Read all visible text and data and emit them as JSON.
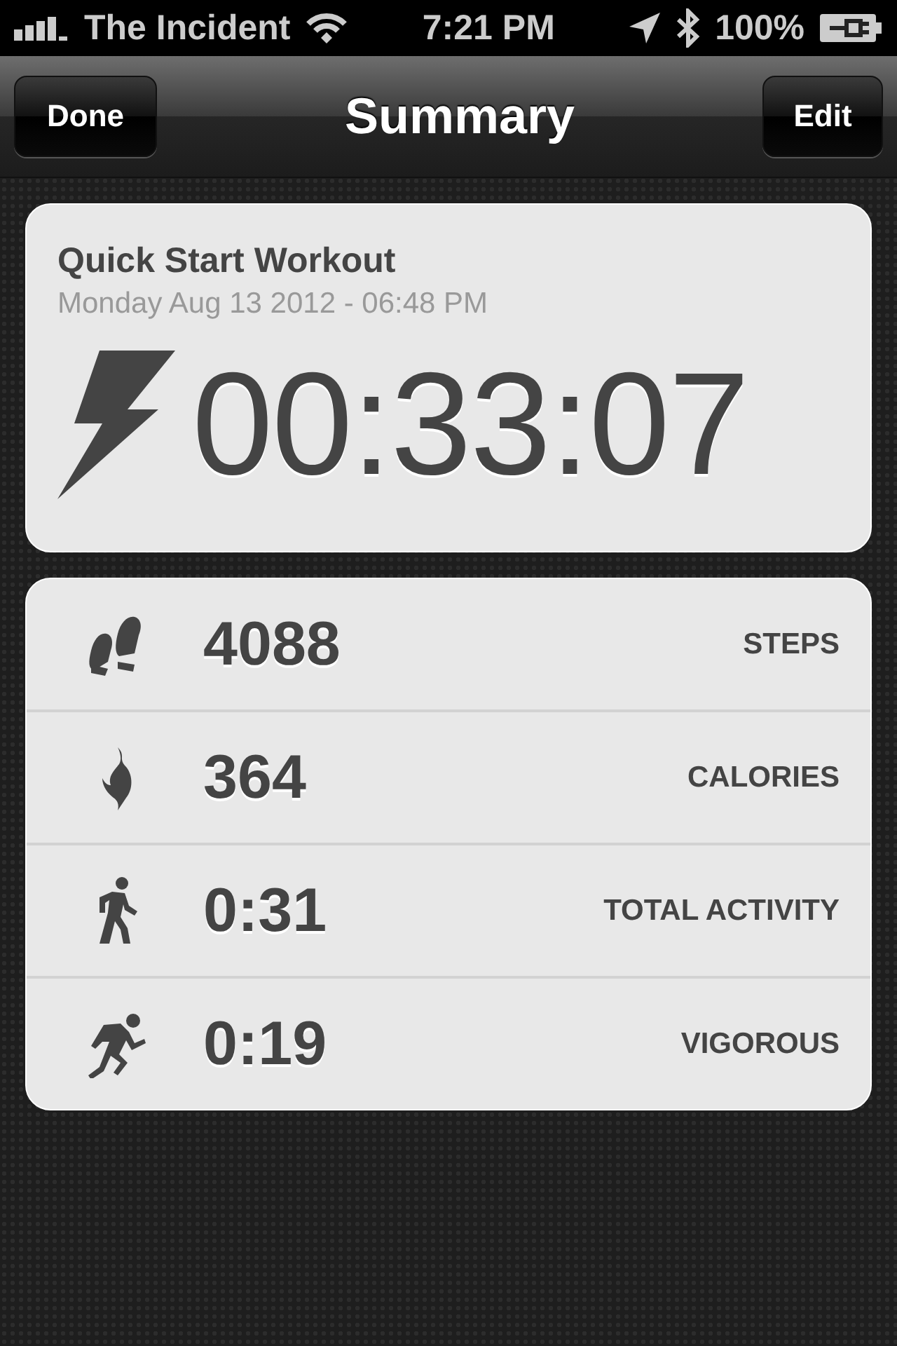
{
  "status_bar": {
    "carrier": "The Incident",
    "time": "7:21 PM",
    "battery": "100%"
  },
  "nav": {
    "left_button": "Done",
    "title": "Summary",
    "right_button": "Edit"
  },
  "workout": {
    "name": "Quick Start Workout",
    "date": "Monday Aug 13 2012 - 06:48 PM",
    "duration": "00:33:07"
  },
  "stats": [
    {
      "kind": "steps",
      "value": "4088",
      "label": "STEPS"
    },
    {
      "kind": "calories",
      "value": "364",
      "label": "CALORIES"
    },
    {
      "kind": "activity",
      "value": "0:31",
      "label": "TOTAL ACTIVITY"
    },
    {
      "kind": "vigorous",
      "value": "0:19",
      "label": "VIGOROUS"
    }
  ]
}
